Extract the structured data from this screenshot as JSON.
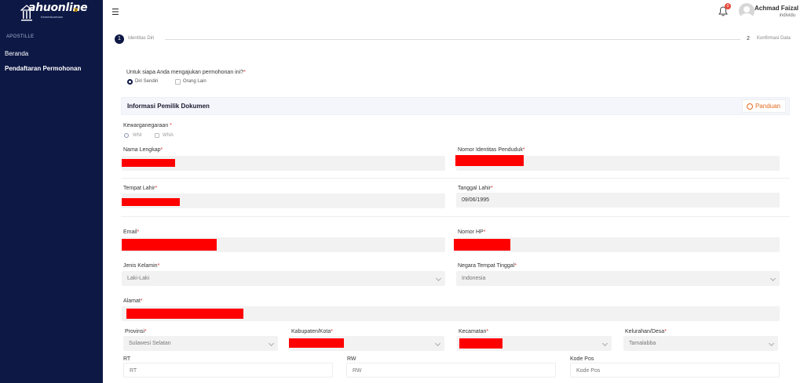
{
  "app": {
    "logo_text": "ahuonline",
    "logo_sub": "Kemenkumham"
  },
  "sidebar": {
    "section": "APOSTILLE",
    "items": [
      {
        "label": "Beranda"
      },
      {
        "label": "Pendaftaran Permohonan"
      }
    ]
  },
  "header": {
    "notification_count": "0",
    "user_name": "Achmad Faizal",
    "user_role": "individu"
  },
  "stepper": {
    "step1_num": "1",
    "step1_label": "Identitas Diri",
    "step2_num": "2",
    "step2_label": "Konfirmasi Data"
  },
  "question": {
    "text": "Untuk siapa Anda mengajukan permohonan ini?",
    "options": [
      "Diri Sendiri",
      "Orang Lain"
    ],
    "selected": "Diri Sendiri"
  },
  "section": {
    "title": "Informasi Pemilik Dokumen",
    "panduan": "Panduan"
  },
  "form": {
    "kewarganegaraan_label": "Kewarganegaraan",
    "kewarganegaraan_options": [
      "WNI",
      "WNA"
    ],
    "kewarganegaraan_selected": "WNI",
    "nama_label": "Nama Lengkap",
    "nik_label": "Nomor Identitas Penduduk",
    "tempat_lahir_label": "Tempat Lahir",
    "tanggal_lahir_label": "Tanggal Lahir",
    "tanggal_lahir_value": "09/06/1995",
    "email_label": "Email",
    "hp_label": "Nomor HP",
    "jk_label": "Jenis Kelamin",
    "jk_value": "Laki-Laki",
    "negara_label": "Negara Tempat Tinggal",
    "negara_value": "Indonesia",
    "alamat_label": "Alamat",
    "provinsi_label": "Provinsi",
    "provinsi_value": "Sulawesi Selatan",
    "kabkota_label": "Kabupaten/Kota",
    "kecamatan_label": "Kecamatan",
    "kelurahan_label": "Kelurahan/Desa",
    "kelurahan_value": "Tamalabba",
    "rt_label": "RT",
    "rt_placeholder": "RT",
    "rw_label": "RW",
    "rw_placeholder": "RW",
    "kodepos_label": "Kode Pos",
    "kodepos_placeholder": "Kode Pos",
    "required_mark": "*"
  },
  "colors": {
    "sidebar_bg": "#0d1845",
    "accent_orange": "#e26a1c",
    "required_red": "#e03030",
    "redaction": "#ff0000"
  }
}
